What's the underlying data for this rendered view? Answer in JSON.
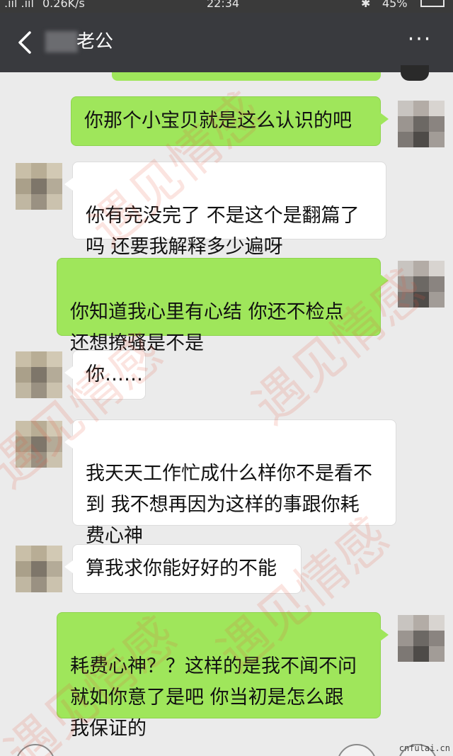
{
  "status_bar": {
    "signal": ".ııl .ııl",
    "network_speed": "0.26K/s",
    "time": "22:34",
    "bluetooth": "✱",
    "battery": "45%"
  },
  "header": {
    "back_icon": "chevron-left-icon",
    "contact_name_suffix": "老公",
    "more_label": "···"
  },
  "messages": [
    {
      "side": "me",
      "text": "你那个小宝贝就是这么认识的吧"
    },
    {
      "side": "other",
      "text": "你有完没完了 不是这个是翻篇了\n吗  还要我解释多少遍呀"
    },
    {
      "side": "me",
      "text": "你知道我心里有心结 你还不检点\n还想撩骚是不是"
    },
    {
      "side": "other",
      "text": "你……"
    },
    {
      "side": "other",
      "text": "我天天工作忙成什么样你不是看不\n到  我不想再因为这样的事跟你耗\n费心神"
    },
    {
      "side": "other",
      "text": "算我求你能好好的不能"
    },
    {
      "side": "me",
      "text": "耗费心神？？这样的是我不闻不问\n就如你意了是吧  你当初是怎么跟\n我保证的"
    }
  ],
  "watermark": {
    "text": "遇见情感",
    "site": "cnfulai.cn"
  },
  "colors": {
    "header_bg": "#393a3e",
    "my_bubble": "#9fe65b",
    "other_bubble": "#ffffff",
    "chat_bg": "#ebebeb"
  }
}
